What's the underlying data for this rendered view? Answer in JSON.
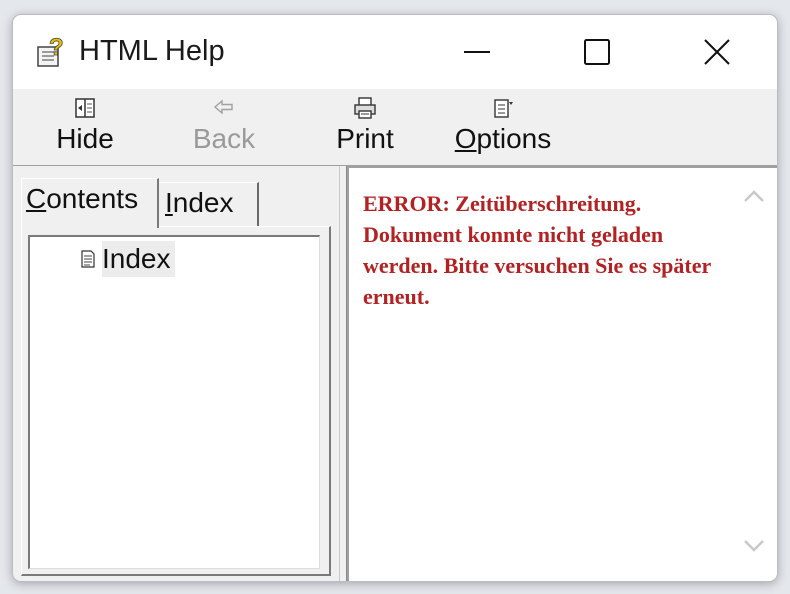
{
  "window": {
    "title": "HTML Help",
    "app_icon": "help-book-icon"
  },
  "title_controls": {
    "minimize_icon": "minimize-icon",
    "maximize_icon": "maximize-icon",
    "close_icon": "close-icon"
  },
  "toolbar": {
    "hide_label": "Hide",
    "back_label": "Back",
    "print_label": "Print",
    "options_label_first": "O",
    "options_label_rest": "ptions",
    "back_enabled": false
  },
  "navigation": {
    "tabs": [
      {
        "label_first": "C",
        "label_rest": "ontents",
        "selected": true
      },
      {
        "label_first": "I",
        "label_rest": "ndex",
        "label_prefix": "",
        "selected": false
      }
    ],
    "tree": [
      {
        "label": "Index",
        "icon": "document-icon"
      }
    ]
  },
  "content": {
    "error_message": "ERROR: Zeitüberschreitung. Dokument konnte nicht geladen werden. Bitte versuchen Sie es später erneut.",
    "error_color": "#b22222"
  }
}
